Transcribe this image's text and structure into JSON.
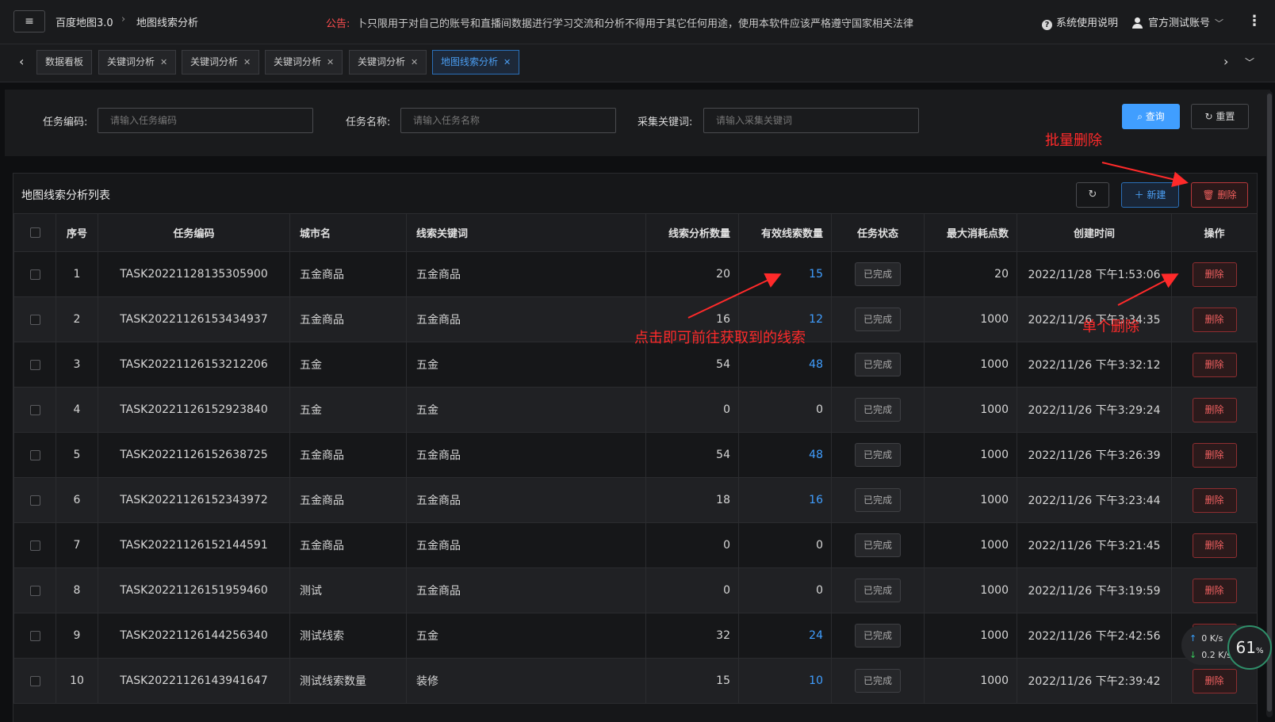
{
  "header": {
    "menu_icon": "≡",
    "brand": "百度地图3.0",
    "breadcrumb_sep": "›",
    "breadcrumb_current": "地图线索分析",
    "notice_label": "公告:",
    "notice_text": "卜只限用于对自己的账号和直播间数据进行学习交流和分析不得用于其它任何用途，使用本软件应该严格遵守国家相关法律",
    "help_label": "系统使用说明",
    "user_label": "官方测试账号"
  },
  "tabs": [
    {
      "label": "数据看板",
      "closable": false,
      "active": false
    },
    {
      "label": "关键词分析",
      "closable": true,
      "active": false
    },
    {
      "label": "关键词分析",
      "closable": true,
      "active": false
    },
    {
      "label": "关键词分析",
      "closable": true,
      "active": false
    },
    {
      "label": "关键词分析",
      "closable": true,
      "active": false
    },
    {
      "label": "地图线索分析",
      "closable": true,
      "active": true
    }
  ],
  "search": {
    "task_code_label": "任务编码:",
    "task_code_placeholder": "请输入任务编码",
    "task_name_label": "任务名称:",
    "task_name_placeholder": "请输入任务名称",
    "keyword_label": "采集关键词:",
    "keyword_placeholder": "请输入采集关键词",
    "query_label": "查询",
    "reset_label": "重置"
  },
  "list": {
    "title": "地图线索分析列表",
    "new_label": "新建",
    "delete_label": "删除",
    "columns": [
      "序号",
      "任务编码",
      "城市名",
      "线索关键词",
      "线索分析数量",
      "有效线索数量",
      "任务状态",
      "最大消耗点数",
      "创建时间",
      "操作"
    ],
    "rows": [
      {
        "no": "1",
        "code": "TASK20221128135305900",
        "city": "五金商品",
        "keyword": "五金商品",
        "analyzed": "20",
        "valid": "15",
        "status": "已完成",
        "max_points": "20",
        "created": "2022/11/28 下午1:53:06",
        "action": "删除"
      },
      {
        "no": "2",
        "code": "TASK20221126153434937",
        "city": "五金商品",
        "keyword": "五金商品",
        "analyzed": "16",
        "valid": "12",
        "status": "已完成",
        "max_points": "1000",
        "created": "2022/11/26 下午3:34:35",
        "action": "删除"
      },
      {
        "no": "3",
        "code": "TASK20221126153212206",
        "city": "五金",
        "keyword": "五金",
        "analyzed": "54",
        "valid": "48",
        "status": "已完成",
        "max_points": "1000",
        "created": "2022/11/26 下午3:32:12",
        "action": "删除"
      },
      {
        "no": "4",
        "code": "TASK20221126152923840",
        "city": "五金",
        "keyword": "五金",
        "analyzed": "0",
        "valid": "0",
        "status": "已完成",
        "max_points": "1000",
        "created": "2022/11/26 下午3:29:24",
        "action": "删除"
      },
      {
        "no": "5",
        "code": "TASK20221126152638725",
        "city": "五金商品",
        "keyword": "五金商品",
        "analyzed": "54",
        "valid": "48",
        "status": "已完成",
        "max_points": "1000",
        "created": "2022/11/26 下午3:26:39",
        "action": "删除"
      },
      {
        "no": "6",
        "code": "TASK20221126152343972",
        "city": "五金商品",
        "keyword": "五金商品",
        "analyzed": "18",
        "valid": "16",
        "status": "已完成",
        "max_points": "1000",
        "created": "2022/11/26 下午3:23:44",
        "action": "删除"
      },
      {
        "no": "7",
        "code": "TASK20221126152144591",
        "city": "五金商品",
        "keyword": "五金商品",
        "analyzed": "0",
        "valid": "0",
        "status": "已完成",
        "max_points": "1000",
        "created": "2022/11/26 下午3:21:45",
        "action": "删除"
      },
      {
        "no": "8",
        "code": "TASK20221126151959460",
        "city": "测试",
        "keyword": "五金商品",
        "analyzed": "0",
        "valid": "0",
        "status": "已完成",
        "max_points": "1000",
        "created": "2022/11/26 下午3:19:59",
        "action": "删除"
      },
      {
        "no": "9",
        "code": "TASK20221126144256340",
        "city": "测试线索",
        "keyword": "五金",
        "analyzed": "32",
        "valid": "24",
        "status": "已完成",
        "max_points": "1000",
        "created": "2022/11/26 下午2:42:56",
        "action": "删除"
      },
      {
        "no": "10",
        "code": "TASK20221126143941647",
        "city": "测试线索数量",
        "keyword": "装修",
        "analyzed": "15",
        "valid": "10",
        "status": "已完成",
        "max_points": "1000",
        "created": "2022/11/26 下午2:39:42",
        "action": "删除"
      }
    ]
  },
  "annotations": {
    "batch_delete": "批量删除",
    "click_lead": "点击即可前往获取到的线索",
    "single_delete": "单个删除"
  },
  "speed_widget": {
    "up": "0",
    "up_unit": "K/s",
    "down": "0.2",
    "down_unit": "K/s",
    "percent": "61",
    "percent_unit": "%"
  },
  "colors": {
    "accent": "#409eff",
    "danger": "#f06060",
    "annotation": "#ff2a2a",
    "background": "#0e0f11"
  },
  "icons": {
    "search": "search-icon",
    "refresh": "refresh-icon",
    "plus": "plus-icon",
    "trash": "trash-icon",
    "help": "help-icon",
    "user": "user-icon",
    "more": "more-vertical-icon"
  }
}
